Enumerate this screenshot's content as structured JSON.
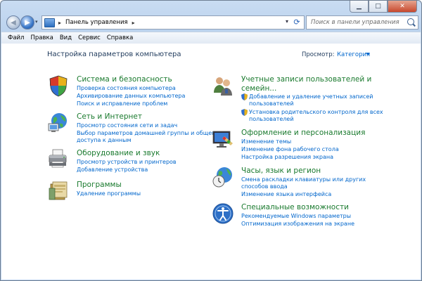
{
  "window": {
    "address": {
      "path": "Панель управления"
    },
    "search": {
      "placeholder": "Поиск в панели управления"
    }
  },
  "menu": [
    "Файл",
    "Правка",
    "Вид",
    "Сервис",
    "Справка"
  ],
  "main": {
    "heading": "Настройка параметров компьютера",
    "view_by_label": "Просмотр:",
    "view_by_value": "Категория"
  },
  "categories": [
    {
      "title": [
        "Система и безопасность"
      ],
      "icon": "system-security-icon",
      "links": [
        [
          "Проверка состояния компьютера"
        ],
        [
          "Архивирование данных компьютера"
        ],
        [
          "Поиск и исправление проблем"
        ]
      ]
    },
    {
      "title": [
        "Сеть и Интернет"
      ],
      "icon": "network-internet-icon",
      "links": [
        [
          "Просмотр состояния сети и задач"
        ],
        [
          "Выбор параметров домашней группы и общего",
          "доступа к данным"
        ]
      ]
    },
    {
      "title": [
        "Оборудование и звук"
      ],
      "icon": "hardware-sound-icon",
      "links": [
        [
          "Просмотр устройств и принтеров"
        ],
        [
          "Добавление устройства"
        ]
      ]
    },
    {
      "title": [
        "Программы"
      ],
      "icon": "programs-icon",
      "links": [
        [
          "Удаление программы"
        ]
      ]
    },
    {
      "title": [
        "Учетные записи пользователей и",
        "семейн..."
      ],
      "icon": "user-accounts-icon",
      "links": [
        [
          "Добавление и удаление учетных записей",
          "пользователей"
        ],
        [
          "Установка родительского контроля для всех",
          "пользователей"
        ]
      ]
    },
    {
      "title": [
        "Оформление и персонализация"
      ],
      "icon": "appearance-personalization-icon",
      "links": [
        [
          "Изменение темы"
        ],
        [
          "Изменение фона рабочего стола"
        ],
        [
          "Настройка разрешения экрана"
        ]
      ]
    },
    {
      "title": [
        "Часы, язык и регион"
      ],
      "icon": "clock-language-region-icon",
      "links": [
        [
          "Смена раскладки клавиатуры или других",
          "способов ввода"
        ],
        [
          "Изменение языка интерфейса"
        ]
      ]
    },
    {
      "title": [
        "Специальные возможности"
      ],
      "icon": "ease-of-access-icon",
      "links": [
        [
          "Рекомендуемые Windows параметры"
        ],
        [
          "Оптимизация изображения на экране"
        ]
      ]
    }
  ]
}
